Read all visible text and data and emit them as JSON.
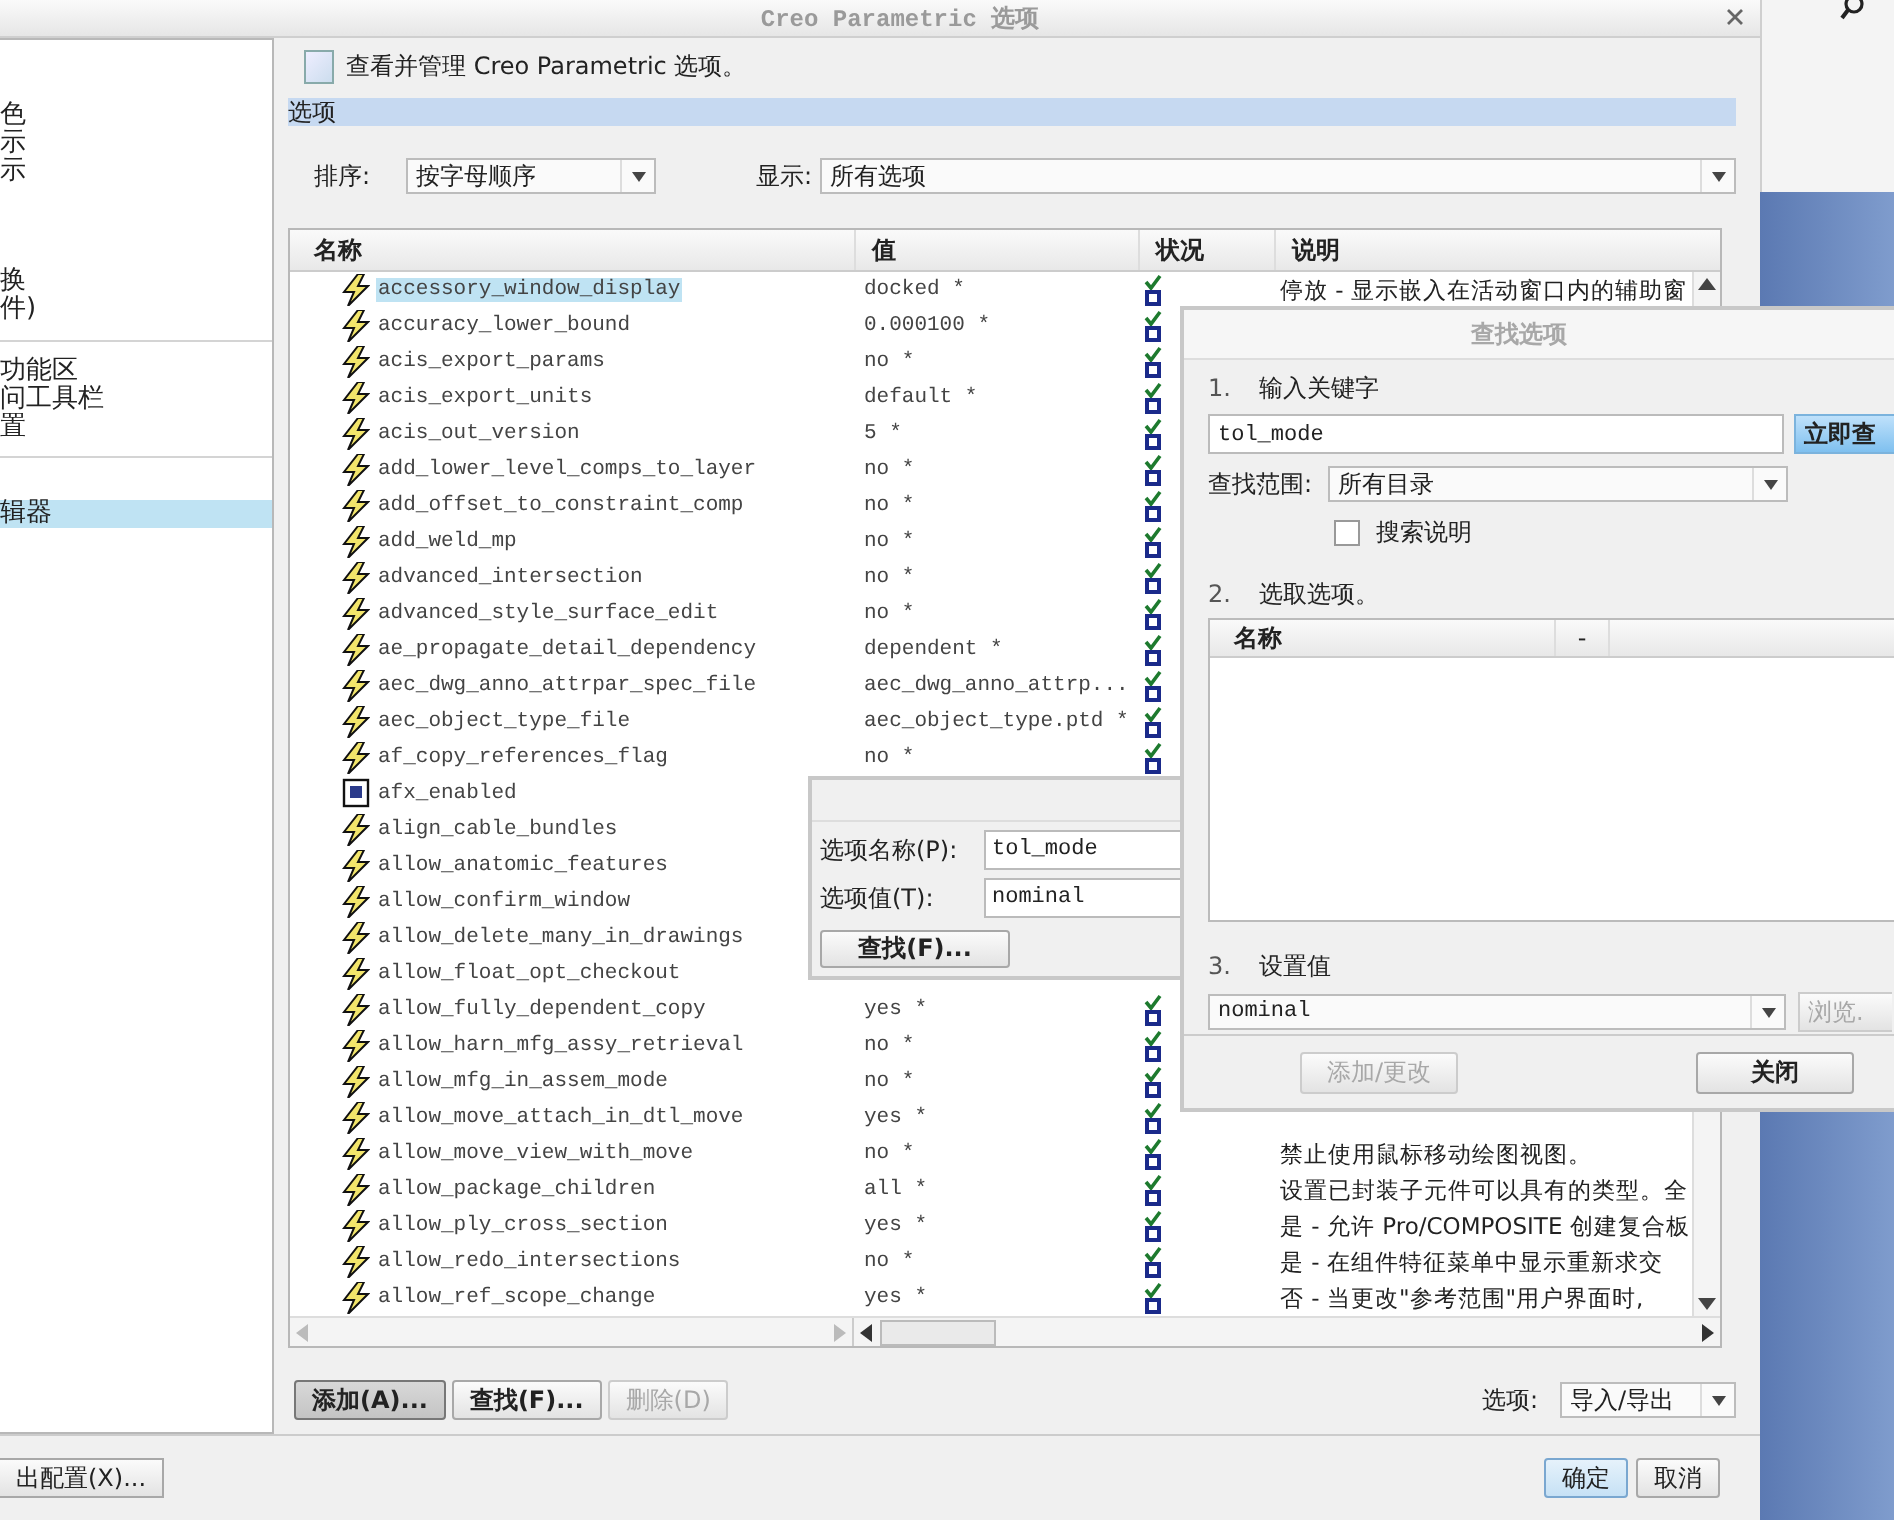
{
  "window": {
    "title": "Creo Parametric 选项"
  },
  "sidebar": {
    "groups": [
      {
        "items": [
          {
            "label": "色",
            "selected": false
          },
          {
            "label": "示",
            "selected": false
          },
          {
            "label": "示",
            "selected": false
          },
          {
            "label": "换",
            "selected": false
          },
          {
            "label": "件)",
            "selected": false
          }
        ]
      },
      {
        "items": [
          {
            "label": "功能区",
            "selected": false
          },
          {
            "label": "问工具栏",
            "selected": false
          },
          {
            "label": "置",
            "selected": false
          }
        ]
      },
      {
        "items": [
          {
            "label": "辑器",
            "selected": true
          }
        ]
      }
    ]
  },
  "header": {
    "text": "查看并管理 Creo Parametric 选项。"
  },
  "section": {
    "title": "选项"
  },
  "sort": {
    "label": "排序:",
    "value": "按字母顺序"
  },
  "show": {
    "label": "显示:",
    "value": "所有选项"
  },
  "table": {
    "columns": [
      "名称",
      "值",
      "状况",
      "说明"
    ],
    "rows": [
      {
        "kind": "lightning",
        "name": "accessory_window_display",
        "value": "docked *",
        "checked": true,
        "description": "停放 - 显示嵌入在活动窗口内的辅助窗",
        "selected": true
      },
      {
        "kind": "lightning",
        "name": "accuracy_lower_bound",
        "value": "0.000100 *",
        "checked": true,
        "selected": false
      },
      {
        "kind": "lightning",
        "name": "acis_export_params",
        "value": "no *",
        "checked": true,
        "selected": false
      },
      {
        "kind": "lightning",
        "name": "acis_export_units",
        "value": "default *",
        "checked": true,
        "selected": false
      },
      {
        "kind": "lightning",
        "name": "acis_out_version",
        "value": "5 *",
        "checked": true,
        "selected": false
      },
      {
        "kind": "lightning",
        "name": "add_lower_level_comps_to_layer",
        "value": "no *",
        "checked": true,
        "selected": false
      },
      {
        "kind": "lightning",
        "name": "add_offset_to_constraint_comp",
        "value": "no *",
        "checked": true,
        "selected": false
      },
      {
        "kind": "lightning",
        "name": "add_weld_mp",
        "value": "no *",
        "checked": true,
        "selected": false
      },
      {
        "kind": "lightning",
        "name": "advanced_intersection",
        "value": "no *",
        "checked": true,
        "selected": false
      },
      {
        "kind": "lightning",
        "name": "advanced_style_surface_edit",
        "value": "no *",
        "checked": true,
        "selected": false
      },
      {
        "kind": "lightning",
        "name": "ae_propagate_detail_dependency",
        "value": "dependent *",
        "checked": true,
        "selected": false
      },
      {
        "kind": "lightning",
        "name": "aec_dwg_anno_attrpar_spec_file",
        "value": "aec_dwg_anno_attrp...",
        "checked": true,
        "selected": false
      },
      {
        "kind": "lightning",
        "name": "aec_object_type_file",
        "value": "aec_object_type.ptd *",
        "checked": true,
        "selected": false
      },
      {
        "kind": "lightning",
        "name": "af_copy_references_flag",
        "value": "no *",
        "checked": true,
        "selected": false
      },
      {
        "kind": "box",
        "name": "afx_enabled",
        "selected": false
      },
      {
        "kind": "lightning",
        "name": "align_cable_bundles",
        "selected": false
      },
      {
        "kind": "lightning",
        "name": "allow_anatomic_features",
        "selected": false
      },
      {
        "kind": "lightning",
        "name": "allow_confirm_window",
        "selected": false
      },
      {
        "kind": "lightning",
        "name": "allow_delete_many_in_drawings",
        "selected": false
      },
      {
        "kind": "lightning",
        "name": "allow_float_opt_checkout",
        "selected": false
      },
      {
        "kind": "lightning",
        "name": "allow_fully_dependent_copy",
        "value": "yes *",
        "checked": true,
        "selected": false
      },
      {
        "kind": "lightning",
        "name": "allow_harn_mfg_assy_retrieval",
        "value": "no *",
        "checked": true,
        "selected": false
      },
      {
        "kind": "lightning",
        "name": "allow_mfg_in_assem_mode",
        "value": "no *",
        "checked": true,
        "selected": false
      },
      {
        "kind": "lightning",
        "name": "allow_move_attach_in_dtl_move",
        "value": "yes *",
        "checked": true,
        "selected": false
      },
      {
        "kind": "lightning",
        "name": "allow_move_view_with_move",
        "value": "no *",
        "checked": true,
        "description": "禁止使用鼠标移动绘图视图。",
        "selected": false
      },
      {
        "kind": "lightning",
        "name": "allow_package_children",
        "value": "all *",
        "checked": true,
        "description": "设置已封装子元件可以具有的类型。全",
        "selected": false
      },
      {
        "kind": "lightning",
        "name": "allow_ply_cross_section",
        "value": "yes *",
        "checked": true,
        "description": "是 - 允许 Pro/COMPOSITE 创建复合板",
        "selected": false
      },
      {
        "kind": "lightning",
        "name": "allow_redo_intersections",
        "value": "no *",
        "checked": true,
        "description": "是 - 在组件特征菜单中显示重新求交",
        "selected": false
      },
      {
        "kind": "lightning",
        "name": "allow_ref_scope_change",
        "value": "yes *",
        "checked": true,
        "description": "否 - 当更改\"参考范围\"用户界面时,",
        "selected": false
      }
    ]
  },
  "buttons": [
    {
      "label": "添加(A)...",
      "pressed": true,
      "disabled": false
    },
    {
      "label": "查找(F)...",
      "pressed": false,
      "disabled": false
    },
    {
      "label": "删除(D)",
      "pressed": false,
      "disabled": true
    }
  ],
  "options_menu": {
    "label": "选项:",
    "value": "导入/导出"
  },
  "footer": {
    "export_button": "出配置(X)...",
    "ok_button": "确定",
    "cancel_button": "取消"
  },
  "value_dialog": {
    "name_label": "选项名称(P):",
    "name_value": "tol_mode",
    "value_label": "选项值(T):",
    "value_value": "nominal",
    "find_button": "查找(F)..."
  },
  "find_dialog": {
    "title": "查找选项",
    "step1": {
      "number": "1.",
      "label": "输入关键字",
      "value": "tol_mode",
      "search_button": "立即查"
    },
    "scope": {
      "label": "查找范围:",
      "value": "所有目录"
    },
    "search_description": {
      "label": "搜索说明",
      "checked": false
    },
    "step2": {
      "number": "2.",
      "label": "选取选项。",
      "columns": [
        "名称",
        "-"
      ]
    },
    "step3": {
      "number": "3.",
      "label": "设置值",
      "value": "nominal",
      "browse_button": "浏览."
    },
    "add_button": {
      "label": "添加/更改",
      "disabled": true
    },
    "close_button": {
      "label": "关闭",
      "disabled": false
    }
  }
}
